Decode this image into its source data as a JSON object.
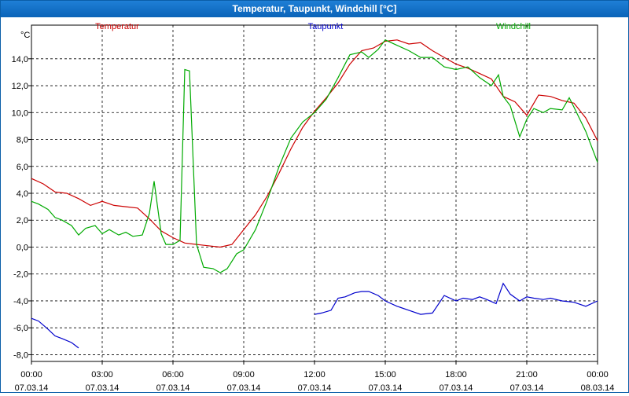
{
  "window": {
    "title": "Temperatur, Taupunkt, Windchill [°C]"
  },
  "chart_data": {
    "type": "line",
    "title": "Temperatur, Taupunkt, Windchill [°C]",
    "ylabel": "°C",
    "ylim": [
      -8.5,
      16.5
    ],
    "xlim": [
      0,
      24
    ],
    "grid": true,
    "colors": {
      "Temperatur": "#cc0000",
      "Taupunkt": "#0000cc",
      "Windchill": "#00aa00"
    },
    "y_ticks": [
      -8.0,
      -6.0,
      -4.0,
      -2.0,
      0.0,
      2.0,
      4.0,
      6.0,
      8.0,
      10.0,
      12.0,
      14.0
    ],
    "y_tick_labels": [
      "-8,0",
      "-6,0",
      "-4,0",
      "-2,0",
      "0,0",
      "2,0",
      "4,0",
      "6,0",
      "8,0",
      "10,0",
      "12,0",
      "14,0"
    ],
    "x_ticks": [
      0,
      3,
      6,
      9,
      12,
      15,
      18,
      21,
      24
    ],
    "x_tick_times": [
      "00:00",
      "03:00",
      "06:00",
      "09:00",
      "12:00",
      "15:00",
      "18:00",
      "21:00",
      "00:00"
    ],
    "x_tick_dates": [
      "07.03.14",
      "07.03.14",
      "07.03.14",
      "07.03.14",
      "07.03.14",
      "07.03.14",
      "07.03.14",
      "07.03.14",
      "08.03.14"
    ],
    "series": [
      {
        "name": "Temperatur",
        "color": "#cc0000",
        "x": [
          0,
          0.5,
          1,
          1.5,
          2,
          2.5,
          3,
          3.5,
          4,
          4.5,
          5,
          5.5,
          6,
          6.5,
          7,
          7.5,
          8,
          8.5,
          9,
          9.5,
          10,
          10.5,
          11,
          11.5,
          12,
          12.5,
          13,
          13.5,
          14,
          14.5,
          15,
          15.5,
          16,
          16.5,
          17,
          17.5,
          18,
          18.5,
          19,
          19.5,
          20,
          20.5,
          21,
          21.5,
          22,
          22.5,
          23,
          23.5,
          24
        ],
        "y": [
          5.1,
          4.7,
          4.1,
          4.0,
          3.6,
          3.1,
          3.4,
          3.1,
          3.0,
          2.9,
          2.1,
          1.2,
          0.7,
          0.3,
          0.2,
          0.1,
          0.0,
          0.2,
          1.3,
          2.4,
          3.8,
          5.5,
          7.3,
          8.9,
          10.1,
          11.1,
          12.2,
          13.6,
          14.6,
          14.8,
          15.3,
          15.4,
          15.1,
          15.2,
          14.6,
          14.1,
          13.6,
          13.3,
          12.9,
          12.5,
          11.2,
          10.8,
          9.8,
          11.3,
          11.2,
          10.9,
          10.7,
          9.6,
          7.9
        ]
      },
      {
        "name": "Taupunkt",
        "color": "#0000cc",
        "segments": [
          {
            "x": [
              0,
              0.3,
              0.7,
              1.0,
              1.3,
              1.7,
              2.0
            ],
            "y": [
              -5.3,
              -5.5,
              -6.1,
              -6.6,
              -6.8,
              -7.1,
              -7.5
            ]
          },
          {
            "x": [
              12,
              12.3,
              12.7,
              13.0,
              13.3,
              13.7,
              14.0,
              14.3,
              14.7,
              15.0,
              15.5,
              16.0,
              16.5,
              17.0,
              17.5,
              18.0,
              18.3,
              18.7,
              19.0,
              19.3,
              19.7,
              20.0,
              20.3,
              20.7,
              21.0,
              21.3,
              21.7,
              22.0,
              22.5,
              23.0,
              23.5,
              24.0
            ],
            "y": [
              -5.0,
              -4.9,
              -4.7,
              -3.8,
              -3.7,
              -3.4,
              -3.3,
              -3.3,
              -3.6,
              -4.0,
              -4.4,
              -4.7,
              -5.0,
              -4.9,
              -3.6,
              -4.0,
              -3.8,
              -3.9,
              -3.7,
              -3.9,
              -4.2,
              -2.7,
              -3.5,
              -4.0,
              -3.7,
              -3.8,
              -3.9,
              -3.8,
              -4.0,
              -4.1,
              -4.4,
              -4.0
            ]
          }
        ]
      },
      {
        "name": "Windchill",
        "color": "#00aa00",
        "x": [
          0,
          0.3,
          0.7,
          1.0,
          1.3,
          1.7,
          2.0,
          2.3,
          2.7,
          3.0,
          3.3,
          3.7,
          4.0,
          4.3,
          4.7,
          5.0,
          5.2,
          5.5,
          5.7,
          6.0,
          6.3,
          6.5,
          6.7,
          7.0,
          7.3,
          7.7,
          8.0,
          8.3,
          8.7,
          9.0,
          9.5,
          10.0,
          10.5,
          11.0,
          11.5,
          12.0,
          12.5,
          13.0,
          13.5,
          14.0,
          14.3,
          14.7,
          15.0,
          15.5,
          16.0,
          16.5,
          17.0,
          17.5,
          18.0,
          18.5,
          19.0,
          19.5,
          19.8,
          20.0,
          20.3,
          20.7,
          21.0,
          21.3,
          21.7,
          22.0,
          22.5,
          22.8,
          23.0,
          23.5,
          24.0
        ],
        "y": [
          3.4,
          3.2,
          2.8,
          2.2,
          2.0,
          1.6,
          0.9,
          1.4,
          1.6,
          1.0,
          1.3,
          0.9,
          1.1,
          0.8,
          0.9,
          2.5,
          4.9,
          1.0,
          0.2,
          0.2,
          0.5,
          13.2,
          13.1,
          0.2,
          -1.5,
          -1.6,
          -1.9,
          -1.6,
          -0.5,
          -0.2,
          1.3,
          3.5,
          6.0,
          8.1,
          9.3,
          10.0,
          11.0,
          12.6,
          14.3,
          14.5,
          14.1,
          14.7,
          15.4,
          15.0,
          14.6,
          14.1,
          14.1,
          13.4,
          13.2,
          13.4,
          12.6,
          12.0,
          12.8,
          11.2,
          10.5,
          8.2,
          9.5,
          10.3,
          10.0,
          10.3,
          10.2,
          11.1,
          10.4,
          8.6,
          6.3
        ]
      }
    ]
  }
}
